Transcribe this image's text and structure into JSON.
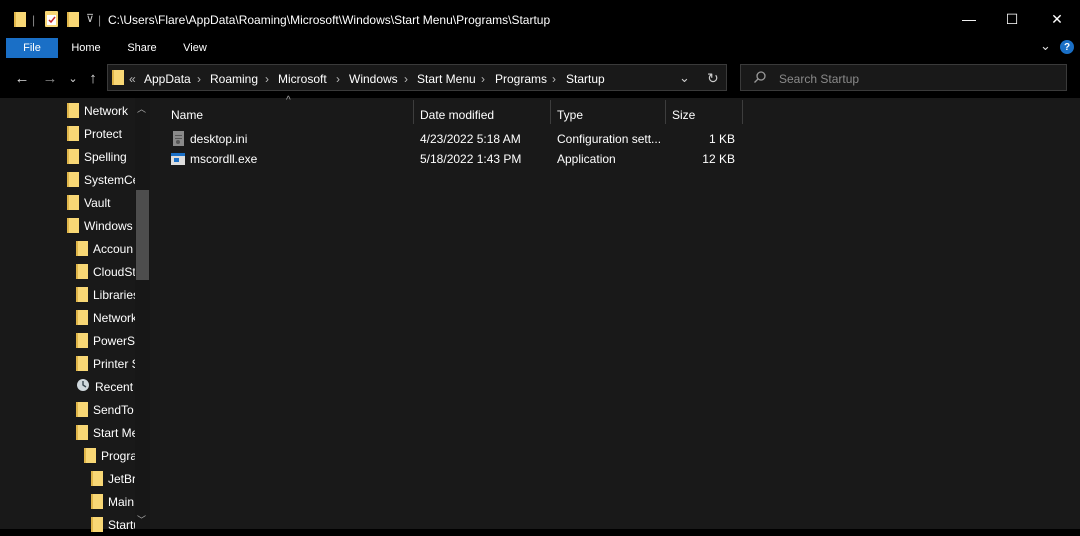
{
  "window": {
    "path_title": "C:\\Users\\Flare\\AppData\\Roaming\\Microsoft\\Windows\\Start Menu\\Programs\\Startup",
    "minimize": "—",
    "maximize": "☐",
    "close": "✕"
  },
  "ribbon": {
    "tabs": [
      "File",
      "Home",
      "Share",
      "View"
    ],
    "help": "?",
    "collapse": "⌄"
  },
  "nav": {
    "back": "←",
    "forward": "→",
    "recent": "⌄",
    "up": "↑",
    "overflow": "«",
    "breadcrumbs": [
      "AppData",
      "Roaming",
      "Microsoft",
      "Windows",
      "Start Menu",
      "Programs",
      "Startup"
    ],
    "dropdown": "⌄",
    "refresh": "↻"
  },
  "search": {
    "placeholder": "Search Startup"
  },
  "tree": {
    "items": [
      {
        "label": "Network",
        "indent": 0,
        "icon": "folder-icon"
      },
      {
        "label": "Protect",
        "indent": 0,
        "icon": "folder-icon"
      },
      {
        "label": "Spelling",
        "indent": 0,
        "icon": "folder-icon"
      },
      {
        "label": "SystemCe",
        "indent": 0,
        "icon": "folder-icon"
      },
      {
        "label": "Vault",
        "indent": 0,
        "icon": "folder-icon"
      },
      {
        "label": "Windows",
        "indent": 0,
        "icon": "folder-icon"
      },
      {
        "label": "Accoun",
        "indent": 1,
        "icon": "folder-icon"
      },
      {
        "label": "CloudSt",
        "indent": 1,
        "icon": "folder-icon"
      },
      {
        "label": "Libraries",
        "indent": 1,
        "icon": "folder-icon"
      },
      {
        "label": "Network",
        "indent": 1,
        "icon": "folder-icon"
      },
      {
        "label": "PowerSh",
        "indent": 1,
        "icon": "folder-icon"
      },
      {
        "label": "Printer S",
        "indent": 1,
        "icon": "folder-icon"
      },
      {
        "label": "Recent I",
        "indent": 1,
        "icon": "recent-items-icon"
      },
      {
        "label": "SendTo",
        "indent": 1,
        "icon": "folder-icon"
      },
      {
        "label": "Start Me",
        "indent": 1,
        "icon": "folder-icon"
      },
      {
        "label": "Progra",
        "indent": 2,
        "icon": "folder-icon"
      },
      {
        "label": "JetBr",
        "indent": 3,
        "icon": "folder-icon"
      },
      {
        "label": "Main",
        "indent": 3,
        "icon": "folder-icon"
      },
      {
        "label": "Startu",
        "indent": 3,
        "icon": "folder-icon"
      }
    ]
  },
  "columns": {
    "name": "Name",
    "date": "Date modified",
    "type": "Type",
    "size": "Size",
    "sort_indicator": "^"
  },
  "files": [
    {
      "name": "desktop.ini",
      "date": "4/23/2022 5:18 AM",
      "type": "Configuration sett...",
      "size": "1 KB",
      "icon": "config-file-icon"
    },
    {
      "name": "mscordll.exe",
      "date": "5/18/2022 1:43 PM",
      "type": "Application",
      "size": "12 KB",
      "icon": "application-icon"
    }
  ],
  "colors": {
    "accent": "#1a6fc6",
    "folder": "#f8d775",
    "background": "#191919"
  }
}
